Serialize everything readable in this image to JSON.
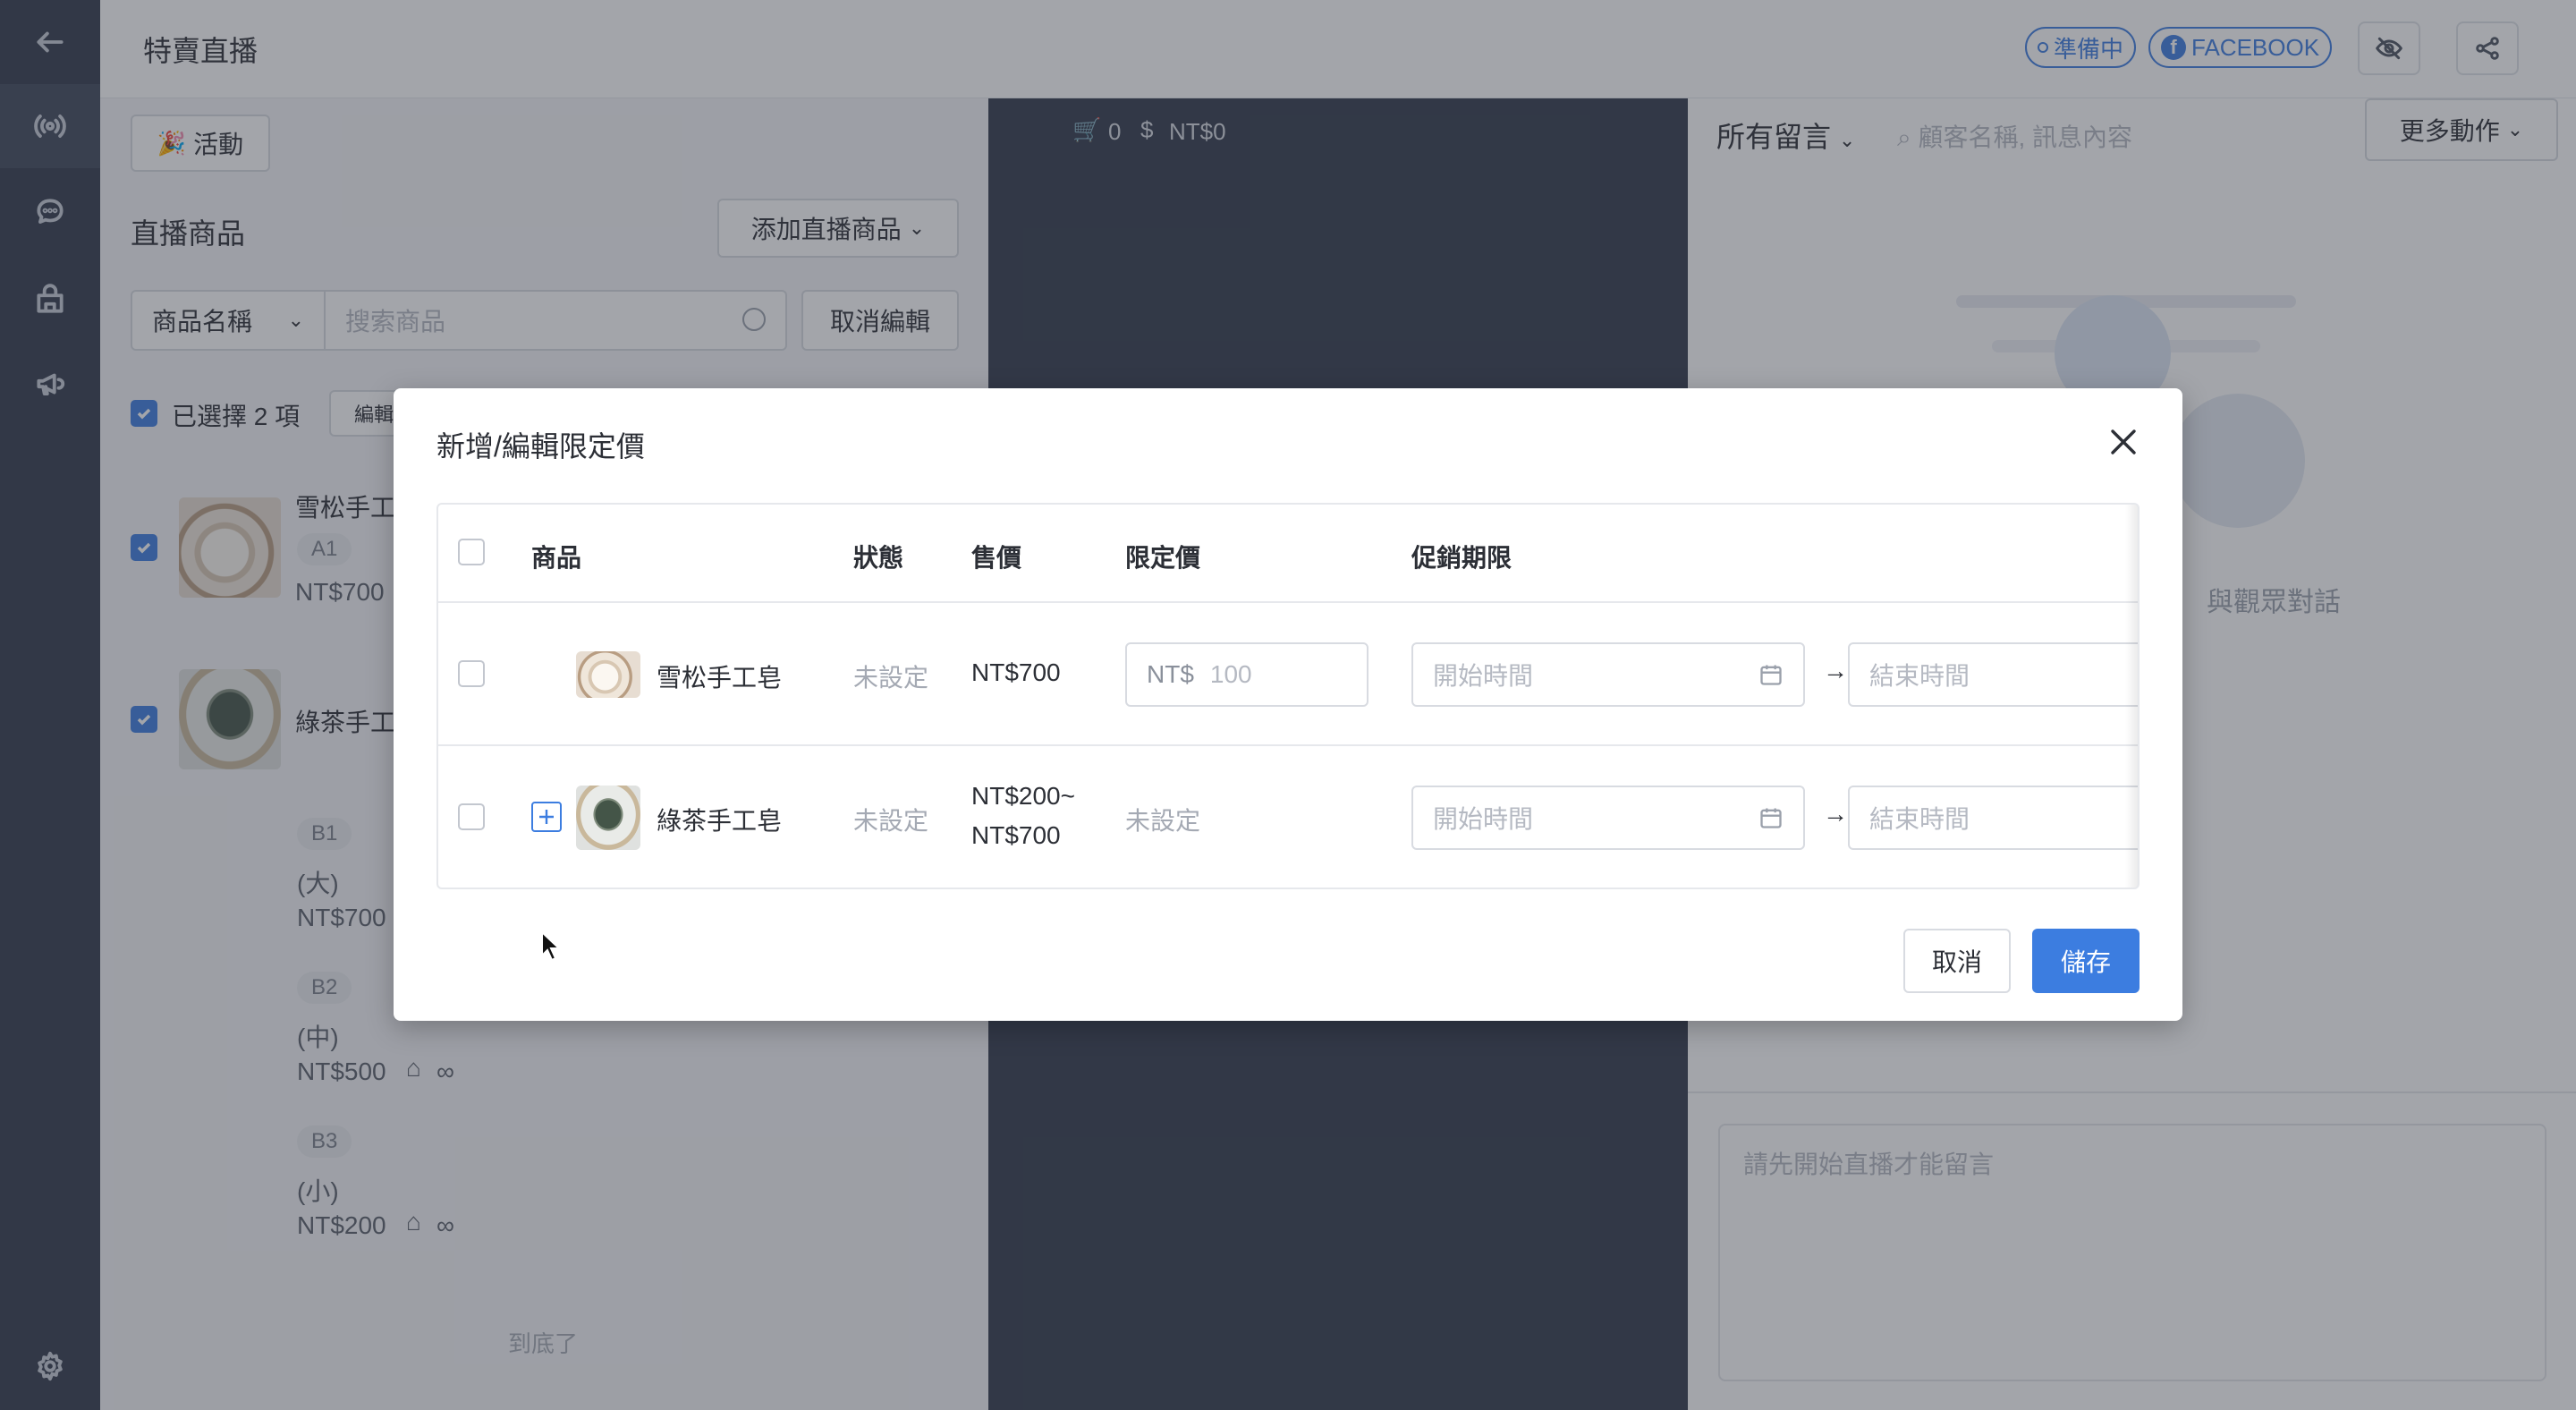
{
  "header": {
    "title": "特賣直播",
    "status_badge": "準備中",
    "platform_badge": "FACEBOOK"
  },
  "left": {
    "activity_button": "活動",
    "section_title": "直播商品",
    "add_product_button": "添加直播商品",
    "filter_select": "商品名稱",
    "search_placeholder": "搜索商品",
    "cancel_edit_button": "取消編輯",
    "selected_text": "已選擇 2 項",
    "edit_button": "編輯",
    "products": [
      {
        "name": "雪松手工",
        "code": "A1",
        "price": "NT$700"
      },
      {
        "name": "綠茶手工"
      }
    ],
    "variants": [
      {
        "code": "B1",
        "size": "(大)",
        "price": "NT$700"
      },
      {
        "code": "B2",
        "size": "(中)",
        "price": "NT$500",
        "stock": "∞"
      },
      {
        "code": "B3",
        "size": "(小)",
        "price": "NT$200",
        "stock": "∞"
      }
    ],
    "end_text": "到底了"
  },
  "center": {
    "cart_count": "0",
    "total": "NT$0"
  },
  "right": {
    "filter": "所有留言",
    "search_placeholder": "顧客名稱, 訊息內容",
    "more_actions": "更多動作",
    "empty_text": "與觀眾對話",
    "comment_placeholder": "請先開始直播才能留言"
  },
  "modal": {
    "title": "新增/編輯限定價",
    "columns": [
      "商品",
      "狀態",
      "售價",
      "限定價",
      "促銷期限"
    ],
    "rows": [
      {
        "name": "雪松手工皂",
        "status": "未設定",
        "price": "NT$700",
        "limited_prefix": "NT$",
        "limited_placeholder": "100"
      },
      {
        "name": "綠茶手工皂",
        "status": "未設定",
        "price_line1": "NT$200~",
        "price_line2": "NT$700",
        "limited": "未設定"
      }
    ],
    "start_placeholder": "開始時間",
    "end_placeholder": "結束時間",
    "arrow": "→",
    "cancel_button": "取消",
    "save_button": "儲存"
  },
  "colors": {
    "primary": "#3c7de0",
    "sidebar": "#323a4b"
  }
}
